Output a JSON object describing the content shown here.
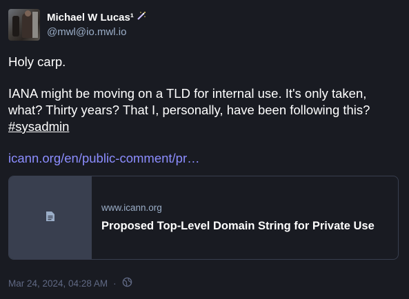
{
  "author": {
    "display_name": "Michael W Lucas¹",
    "badge_icon": "magic-wand-emoji-icon",
    "account": "@mwl@io.mwl.io"
  },
  "post": {
    "paragraph1": "Holy carp.",
    "paragraph2_text": "IANA might be moving on a TLD for internal use. It's only taken, what? Thirty years? That I, personally, have been following this?",
    "hashtag": "#sysadmin",
    "link_text": "icann.org/en/public-comment/pr…"
  },
  "card": {
    "icon": "file-text-icon",
    "host": "www.icann.org",
    "title": "Proposed Top-Level Domain String for Private Use"
  },
  "meta": {
    "timestamp": "Mar 24, 2024, 04:28 AM",
    "separator": "·",
    "visibility_icon": "globe-icon"
  },
  "colors": {
    "background": "#191b22",
    "link": "#8c8dff",
    "muted": "#606984",
    "secondary": "#9baec8",
    "card_border": "#393f4f"
  }
}
